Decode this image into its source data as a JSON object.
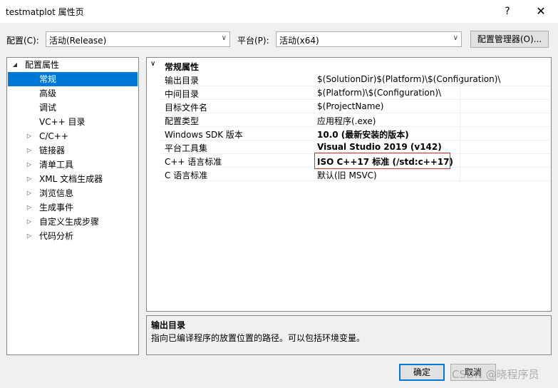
{
  "window": {
    "title": "testmatplot 属性页",
    "help_glyph": "?",
    "close_glyph": "✕"
  },
  "toolbar": {
    "config_label": "配置(C):",
    "config_value": "活动(Release)",
    "platform_label": "平台(P):",
    "platform_value": "活动(x64)",
    "config_manager_label": "配置管理器(O)..."
  },
  "tree": {
    "root": "配置属性",
    "items": [
      {
        "label": "常规",
        "expandable": false,
        "selected": true
      },
      {
        "label": "高级",
        "expandable": false,
        "selected": false
      },
      {
        "label": "调试",
        "expandable": false,
        "selected": false
      },
      {
        "label": "VC++ 目录",
        "expandable": false,
        "selected": false
      },
      {
        "label": "C/C++",
        "expandable": true,
        "selected": false
      },
      {
        "label": "链接器",
        "expandable": true,
        "selected": false
      },
      {
        "label": "清单工具",
        "expandable": true,
        "selected": false
      },
      {
        "label": "XML 文档生成器",
        "expandable": true,
        "selected": false
      },
      {
        "label": "浏览信息",
        "expandable": true,
        "selected": false
      },
      {
        "label": "生成事件",
        "expandable": true,
        "selected": false
      },
      {
        "label": "自定义生成步骤",
        "expandable": true,
        "selected": false
      },
      {
        "label": "代码分析",
        "expandable": true,
        "selected": false
      }
    ]
  },
  "grid": {
    "category": "常规属性",
    "rows": [
      {
        "name": "输出目录",
        "value": "$(SolutionDir)$(Platform)\\$(Configuration)\\",
        "bold": false
      },
      {
        "name": "中间目录",
        "value": "$(Platform)\\$(Configuration)\\",
        "bold": false
      },
      {
        "name": "目标文件名",
        "value": "$(ProjectName)",
        "bold": false
      },
      {
        "name": "配置类型",
        "value": "应用程序(.exe)",
        "bold": false
      },
      {
        "name": "Windows SDK 版本",
        "value": "10.0 (最新安装的版本)",
        "bold": true
      },
      {
        "name": "平台工具集",
        "value": "Visual Studio 2019 (v142)",
        "bold": true
      },
      {
        "name": "C++ 语言标准",
        "value": "ISO C++17 标准 (/std:c++17)",
        "bold": true
      },
      {
        "name": "C 语言标准",
        "value": "默认(旧 MSVC)",
        "bold": false
      }
    ]
  },
  "description": {
    "title": "输出目录",
    "text": "指向已编译程序的放置位置的路径。可以包括环境变量。"
  },
  "buttons": {
    "ok": "确定",
    "cancel": "取消"
  },
  "watermark": "CSDN @晓程序员",
  "colors": {
    "selection": "#0078d7",
    "highlight_border": "#d9302c"
  }
}
